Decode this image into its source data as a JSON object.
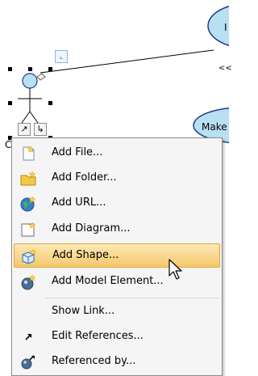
{
  "diagram": {
    "top_usecase_text": "I",
    "right_usecase_text": "Make",
    "stereotype_text": "<<",
    "actor_name_partial": "C"
  },
  "context_menu": {
    "items": [
      {
        "label": "Add File...",
        "icon": "add-file-icon",
        "highlighted": false
      },
      {
        "label": "Add Folder...",
        "icon": "add-folder-icon",
        "highlighted": false
      },
      {
        "label": "Add URL...",
        "icon": "add-url-icon",
        "highlighted": false
      },
      {
        "label": "Add Diagram...",
        "icon": "add-diagram-icon",
        "highlighted": false
      },
      {
        "label": "Add Shape...",
        "icon": "add-shape-icon",
        "highlighted": true
      },
      {
        "label": "Add Model Element...",
        "icon": "add-model-element-icon",
        "highlighted": false
      },
      {
        "label": "Show Link...",
        "icon": "",
        "highlighted": false
      },
      {
        "label": "Edit References...",
        "icon": "arrow-icon",
        "highlighted": false
      },
      {
        "label": "Referenced by...",
        "icon": "referenced-by-icon",
        "highlighted": false
      }
    ]
  },
  "colors": {
    "usecase_fill": "#b9dff3",
    "usecase_stroke": "#1f3a8a",
    "highlight_start": "#fde9b6",
    "highlight_end": "#f6c76a"
  }
}
